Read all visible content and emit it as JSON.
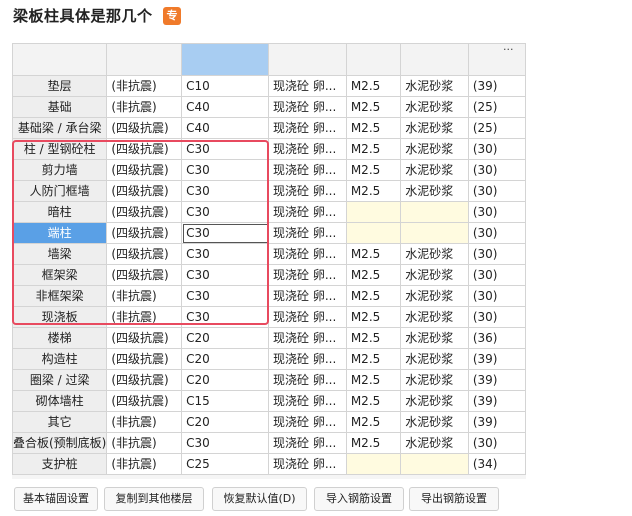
{
  "header": {
    "title": "梁板柱具体是那几个",
    "tag": "专"
  },
  "grid": {
    "more_label": "...",
    "rows": [
      {
        "name": "垫层",
        "seismic": "(非抗震)",
        "concrete": "C10",
        "type": "现浇砼 卵...",
        "mortar_grade": "M2.5",
        "mortar_type": "水泥砂浆",
        "count": "(39)"
      },
      {
        "name": "基础",
        "seismic": "(非抗震)",
        "concrete": "C40",
        "type": "现浇砼 卵...",
        "mortar_grade": "M2.5",
        "mortar_type": "水泥砂浆",
        "count": "(25)"
      },
      {
        "name": "基础梁 / 承台梁",
        "seismic": "(四级抗震)",
        "concrete": "C40",
        "type": "现浇砼 卵...",
        "mortar_grade": "M2.5",
        "mortar_type": "水泥砂浆",
        "count": "(25)"
      },
      {
        "name": "柱 / 型钢砼柱",
        "seismic": "(四级抗震)",
        "concrete": "C30",
        "type": "现浇砼 卵...",
        "mortar_grade": "M2.5",
        "mortar_type": "水泥砂浆",
        "count": "(30)"
      },
      {
        "name": "剪力墙",
        "seismic": "(四级抗震)",
        "concrete": "C30",
        "type": "现浇砼 卵...",
        "mortar_grade": "M2.5",
        "mortar_type": "水泥砂浆",
        "count": "(30)"
      },
      {
        "name": "人防门框墙",
        "seismic": "(四级抗震)",
        "concrete": "C30",
        "type": "现浇砼 卵...",
        "mortar_grade": "M2.5",
        "mortar_type": "水泥砂浆",
        "count": "(30)"
      },
      {
        "name": "暗柱",
        "seismic": "(四级抗震)",
        "concrete": "C30",
        "type": "现浇砼 卵...",
        "mortar_grade": "",
        "mortar_type": "",
        "count": "(30)"
      },
      {
        "name": "端柱",
        "seismic": "(四级抗震)",
        "concrete": "C30",
        "type": "现浇砼 卵...",
        "mortar_grade": "",
        "mortar_type": "",
        "count": "(30)"
      },
      {
        "name": "墙梁",
        "seismic": "(四级抗震)",
        "concrete": "C30",
        "type": "现浇砼 卵...",
        "mortar_grade": "M2.5",
        "mortar_type": "水泥砂浆",
        "count": "(30)"
      },
      {
        "name": "框架梁",
        "seismic": "(四级抗震)",
        "concrete": "C30",
        "type": "现浇砼 卵...",
        "mortar_grade": "M2.5",
        "mortar_type": "水泥砂浆",
        "count": "(30)"
      },
      {
        "name": "非框架梁",
        "seismic": "(非抗震)",
        "concrete": "C30",
        "type": "现浇砼 卵...",
        "mortar_grade": "M2.5",
        "mortar_type": "水泥砂浆",
        "count": "(30)"
      },
      {
        "name": "现浇板",
        "seismic": "(非抗震)",
        "concrete": "C30",
        "type": "现浇砼 卵...",
        "mortar_grade": "M2.5",
        "mortar_type": "水泥砂浆",
        "count": "(30)"
      },
      {
        "name": "楼梯",
        "seismic": "(四级抗震)",
        "concrete": "C20",
        "type": "现浇砼 卵...",
        "mortar_grade": "M2.5",
        "mortar_type": "水泥砂浆",
        "count": "(36)"
      },
      {
        "name": "构造柱",
        "seismic": "(四级抗震)",
        "concrete": "C20",
        "type": "现浇砼 卵...",
        "mortar_grade": "M2.5",
        "mortar_type": "水泥砂浆",
        "count": "(39)"
      },
      {
        "name": "圈梁 / 过梁",
        "seismic": "(四级抗震)",
        "concrete": "C20",
        "type": "现浇砼 卵...",
        "mortar_grade": "M2.5",
        "mortar_type": "水泥砂浆",
        "count": "(39)"
      },
      {
        "name": "砌体墙柱",
        "seismic": "(四级抗震)",
        "concrete": "C15",
        "type": "现浇砼 卵...",
        "mortar_grade": "M2.5",
        "mortar_type": "水泥砂浆",
        "count": "(39)"
      },
      {
        "name": "其它",
        "seismic": "(非抗震)",
        "concrete": "C20",
        "type": "现浇砼 卵...",
        "mortar_grade": "M2.5",
        "mortar_type": "水泥砂浆",
        "count": "(39)"
      },
      {
        "name": "叠合板(预制底板)",
        "seismic": "(非抗震)",
        "concrete": "C30",
        "type": "现浇砼 卵...",
        "mortar_grade": "M2.5",
        "mortar_type": "水泥砂浆",
        "count": "(30)"
      },
      {
        "name": "支护桩",
        "seismic": "(非抗震)",
        "concrete": "C25",
        "type": "现浇砼 卵...",
        "mortar_grade": "",
        "mortar_type": "",
        "count": "(34)"
      }
    ]
  },
  "buttons": {
    "anchor_settings": "基本锚固设置",
    "copy_to_floors": "复制到其他楼层",
    "restore_defaults": "恢复默认值(D)",
    "import_settings": "导入钢筋设置",
    "export_settings": "导出钢筋设置"
  },
  "colors": {
    "highlight_box": "#e84a5f",
    "selected_row_header": "#5aa0e6",
    "selected_column_header": "#a8cdf2",
    "empty_cell": "#fffbe0",
    "title_tag": "#f07a2a"
  }
}
